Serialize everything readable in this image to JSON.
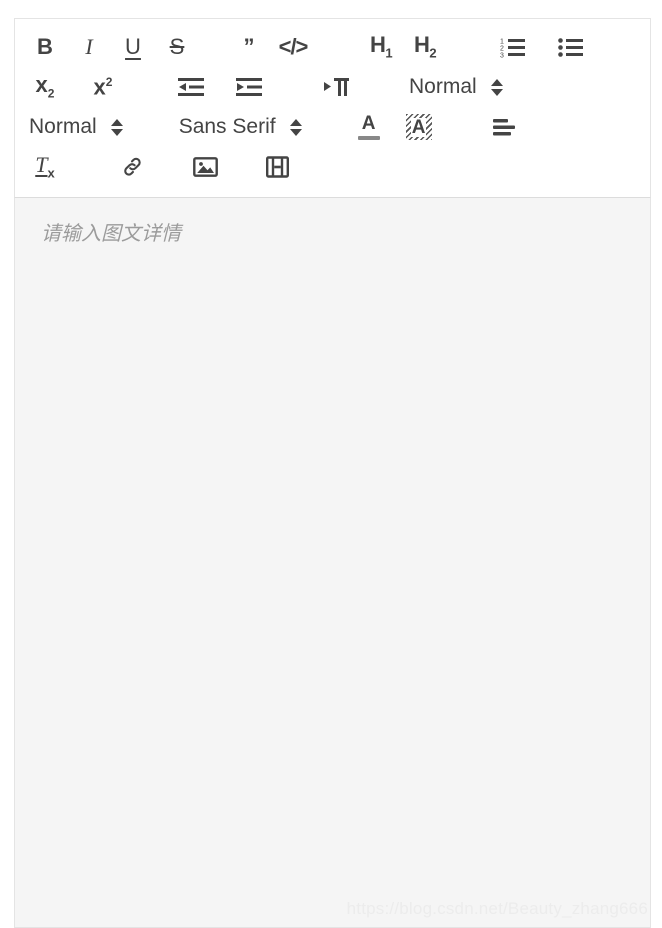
{
  "colors": {
    "toolbar_bg": "#ffffff",
    "editor_bg": "#f5f5f5",
    "icon": "#444444",
    "border": "#e4e4e4",
    "placeholder_text": "#9b9b9b",
    "watermark_text": "#ececec",
    "text_color_swatch": "#888888"
  },
  "toolbar": {
    "row1": {
      "bold_label": "B",
      "italic_label": "I",
      "underline_label": "U",
      "strike_label": "S",
      "blockquote_label": "”",
      "code_block_label": "</>",
      "header1_label": "H",
      "header1_sub": "1",
      "header2_label": "H",
      "header2_sub": "2",
      "ordered_list_label": "ordered-list",
      "bullet_list_label": "bullet-list"
    },
    "row2": {
      "subscript_label": "x",
      "subscript_sub": "2",
      "superscript_label": "x",
      "superscript_sup": "2",
      "outdent_label": "outdent",
      "indent_label": "indent",
      "direction_label": "text-direction",
      "header_picker_value": "Normal"
    },
    "row3": {
      "size_picker_value": "Normal",
      "font_picker_value": "Sans Serif",
      "text_color_label": "A",
      "background_color_label": "A",
      "align_label": "align-left"
    },
    "row4": {
      "clean_label": "T",
      "clean_sub": "x",
      "link_label": "link",
      "image_label": "image",
      "video_label": "video"
    }
  },
  "editor": {
    "placeholder": "请输入图文详情",
    "content": ""
  },
  "watermark": {
    "text": "https://blog.csdn.net/Beauty_zhang666"
  }
}
